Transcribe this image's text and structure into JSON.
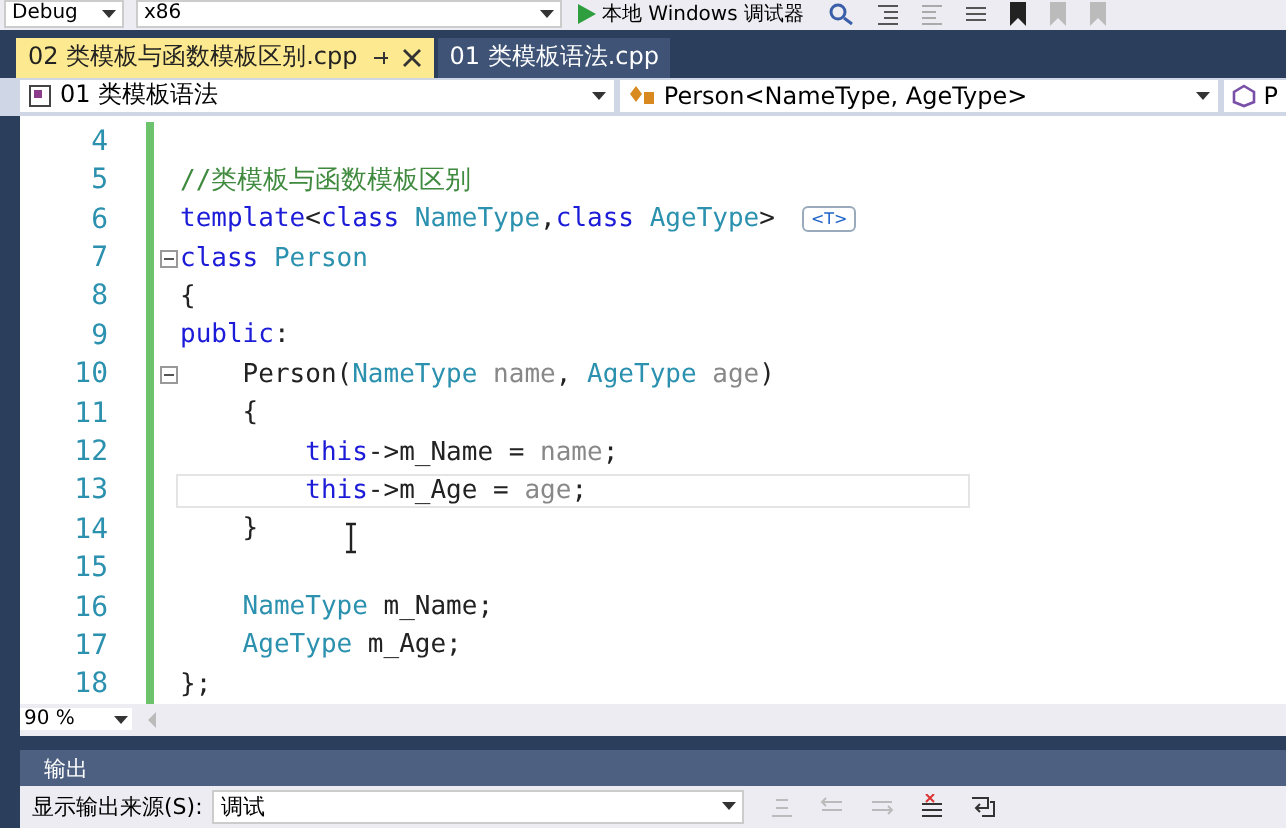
{
  "toolbar": {
    "config": "Debug",
    "platform": "x86",
    "run_label": "本地 Windows 调试器"
  },
  "tabs": [
    {
      "label": "02 类模板与函数模板区别.cpp",
      "selected": true,
      "pinned": true
    },
    {
      "label": "01 类模板语法.cpp",
      "selected": false,
      "pinned": false
    }
  ],
  "nav": {
    "scope": "01 类模板语法",
    "type": "Person<NameType, AgeType>",
    "member": "P"
  },
  "code": [
    {
      "number": "4",
      "fold": false,
      "current": false
    },
    {
      "number": "5",
      "fold": false,
      "current": false,
      "tokens": [
        {
          "kind": "comment",
          "text": "//类模板与函数模板区别"
        }
      ]
    },
    {
      "number": "6",
      "fold": false,
      "current": false,
      "tokens": [
        {
          "kind": "keyword",
          "text": "template"
        },
        {
          "kind": "plain",
          "text": "<"
        },
        {
          "kind": "keyword",
          "text": "class "
        },
        {
          "kind": "type",
          "text": "NameType"
        },
        {
          "kind": "plain",
          "text": ","
        },
        {
          "kind": "keyword",
          "text": "class "
        },
        {
          "kind": "type",
          "text": "AgeType"
        },
        {
          "kind": "plain",
          "text": ">"
        }
      ],
      "hint": "<T>"
    },
    {
      "number": "7",
      "fold": true,
      "current": false,
      "tokens": [
        {
          "kind": "keyword",
          "text": "class "
        },
        {
          "kind": "type",
          "text": "Person"
        }
      ]
    },
    {
      "number": "8",
      "fold": false,
      "current": false,
      "tokens": [
        {
          "kind": "plain",
          "text": "{"
        }
      ]
    },
    {
      "number": "9",
      "fold": false,
      "current": false,
      "tokens": [
        {
          "kind": "keyword",
          "text": "public"
        },
        {
          "kind": "plain",
          "text": ":"
        }
      ]
    },
    {
      "number": "10",
      "fold": true,
      "current": false,
      "tokens": [
        {
          "kind": "plain",
          "text": "    Person("
        },
        {
          "kind": "type",
          "text": "NameType "
        },
        {
          "kind": "param",
          "text": "name"
        },
        {
          "kind": "plain",
          "text": ", "
        },
        {
          "kind": "type",
          "text": "AgeType "
        },
        {
          "kind": "param",
          "text": "age"
        },
        {
          "kind": "plain",
          "text": ")"
        }
      ]
    },
    {
      "number": "11",
      "fold": false,
      "current": false,
      "tokens": [
        {
          "kind": "plain",
          "text": "    {"
        }
      ]
    },
    {
      "number": "12",
      "fold": false,
      "current": false,
      "tokens": [
        {
          "kind": "keyword",
          "text": "        this"
        },
        {
          "kind": "plain",
          "text": "->m_Name = "
        },
        {
          "kind": "param",
          "text": "name"
        },
        {
          "kind": "plain",
          "text": ";"
        }
      ]
    },
    {
      "number": "13",
      "fold": false,
      "current": true,
      "tokens": [
        {
          "kind": "keyword",
          "text": "        this"
        },
        {
          "kind": "plain",
          "text": "->m_Age = "
        },
        {
          "kind": "param",
          "text": "age"
        },
        {
          "kind": "plain",
          "text": ";"
        }
      ]
    },
    {
      "number": "14",
      "fold": false,
      "current": false,
      "tokens": [
        {
          "kind": "plain",
          "text": "    }"
        }
      ]
    },
    {
      "number": "15",
      "fold": false,
      "current": false
    },
    {
      "number": "16",
      "fold": false,
      "current": false,
      "tokens": [
        {
          "kind": "type",
          "text": "    NameType "
        },
        {
          "kind": "plain",
          "text": "m_Name;"
        }
      ]
    },
    {
      "number": "17",
      "fold": false,
      "current": false,
      "tokens": [
        {
          "kind": "type",
          "text": "    AgeType "
        },
        {
          "kind": "plain",
          "text": "m_Age;"
        }
      ]
    },
    {
      "number": "18",
      "fold": false,
      "current": false,
      "tokens": [
        {
          "kind": "plain",
          "text": "};"
        }
      ]
    }
  ],
  "zoom": "90 %",
  "output": {
    "title": "输出",
    "source_label": "显示输出来源(S):",
    "source_value": "调试"
  }
}
